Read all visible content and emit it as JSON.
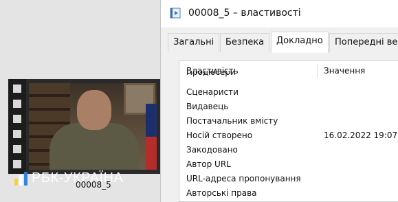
{
  "window": {
    "title": "00008_5 – властивості",
    "tabs": [
      {
        "label": "Загальні"
      },
      {
        "label": "Безпека"
      },
      {
        "label": "Докладно"
      },
      {
        "label": "Попередні вер"
      }
    ],
    "active_tab": "Докладно"
  },
  "details": {
    "header_property": "Властивість",
    "header_value": "Значення",
    "rows": [
      {
        "property": "Продюсери",
        "value": ""
      },
      {
        "property": "Сценаристи",
        "value": ""
      },
      {
        "property": "Видавець",
        "value": ""
      },
      {
        "property": "Постачальник вмісту",
        "value": ""
      },
      {
        "property": "Носій створено",
        "value": "16.02.2022 19:07"
      },
      {
        "property": "Закодовано",
        "value": ""
      },
      {
        "property": "Автор URL",
        "value": ""
      },
      {
        "property": "URL-адреса пропонування",
        "value": ""
      },
      {
        "property": "Авторські права",
        "value": ""
      }
    ]
  },
  "explorer": {
    "file_name": "00008_5",
    "watermark": "РБК-УКРАЇНА"
  },
  "colors": {
    "window_bg": "#ffffff",
    "panel_bg": "#f0f0f0",
    "desktop_bg": "#e4e4e4"
  },
  "icons": {
    "title": "video-file-icon",
    "watermark": "rbc-logo-icon"
  }
}
